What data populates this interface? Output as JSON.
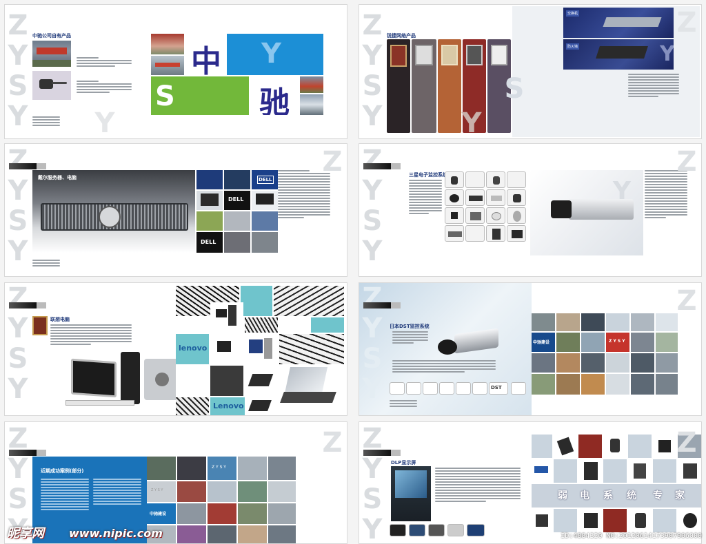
{
  "spreads": {
    "s1": {
      "heading": "中驰公司自有产品",
      "big_chars": [
        "中",
        "驰"
      ],
      "letters": [
        "Y",
        "S"
      ],
      "accent_blue": "#1c8fd6",
      "accent_green": "#72b83a",
      "accent_navy": "#2b2a8c"
    },
    "s2": {
      "heading": "锐捷网络产品",
      "label_switch": "交换机",
      "label_firewall": "防火墙",
      "letters": [
        "Y",
        "S"
      ]
    },
    "s3": {
      "heading": "戴尔服务器、电脑",
      "dell_logo": "DELL"
    },
    "s4": {
      "heading": "三星电子监控系统",
      "letter": "Y"
    },
    "s5": {
      "heading": "联想电脑",
      "lenovo_1": "lenovo",
      "lenovo_2": "Lenovo"
    },
    "s6": {
      "heading": "日本DST监控系统",
      "label_zhongchi": "中驰建设",
      "label_zysy": "Z Y S Y",
      "dst_label": "DST"
    },
    "s7": {
      "heading": "近期成功案例(部分)",
      "label_zhongchi": "中驰建设",
      "label_zysy": "Z Y S Y"
    },
    "s8": {
      "heading": "DLP显示屏",
      "slogan": [
        "弱",
        "电",
        "系",
        "统",
        "专",
        "家"
      ]
    }
  },
  "zysy": [
    "Z",
    "Y",
    "S",
    "Y"
  ],
  "watermark": {
    "logo": "昵享网",
    "url": "www.nipic.com",
    "id": "ID:4884320 NO:20120614173907906000"
  }
}
